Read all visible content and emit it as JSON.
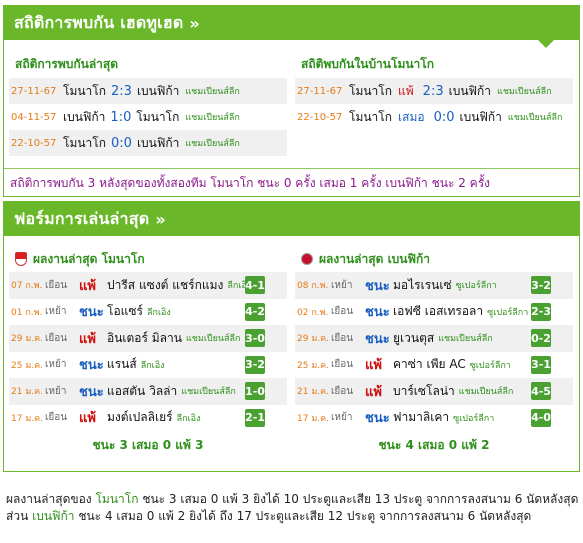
{
  "h2h": {
    "title": "สถิติการพบกัน เฮดทูเฮด",
    "chevron": "»",
    "recent_title": "สถิติการพบกันล่าสุด",
    "home_title": "สถิติพบกันในบ้านโมนาโก",
    "recent": [
      {
        "date": "27-11-67",
        "home": "โมนาโก",
        "score": "2:3",
        "away": "เบนฟิก้า",
        "league": "แชมเปียนส์ลีก"
      },
      {
        "date": "04-11-57",
        "home": "เบนฟิก้า",
        "score": "1:0",
        "away": "โมนาโก",
        "league": "แชมเปียนส์ลีก"
      },
      {
        "date": "22-10-57",
        "home": "โมนาโก",
        "score": "0:0",
        "away": "เบนฟิก้า",
        "league": "แชมเปียนส์ลีก"
      }
    ],
    "home": [
      {
        "date": "27-11-67",
        "home": "โมนาโก",
        "result": "แพ้",
        "score": "2:3",
        "away": "เบนฟิก้า",
        "league": "แชมเปียนส์ลีก"
      },
      {
        "date": "22-10-57",
        "home": "โมนาโก",
        "result": "เสมอ",
        "score": "0:0",
        "away": "เบนฟิก้า",
        "league": "แชมเปียนส์ลีก"
      }
    ],
    "summary": "สถิติการพบกัน 3 หลังสุดของทั้งสองทีม โมนาโก ชนะ 0 ครั้ง เสมอ 1 ครั้ง เบนฟิก้า ชนะ 2 ครั้ง"
  },
  "form": {
    "title": "ฟอร์มการเล่นล่าสุด",
    "chevron": "»",
    "monaco": {
      "title": "ผลงานล่าสุด โมนาโก",
      "rows": [
        {
          "date": "07 ก.พ.",
          "venue": "เยือน",
          "result": "แพ้",
          "code": "L",
          "opp": "ปารีส แซงต์ แชร์กแมง",
          "league": "ลีกเอิง",
          "score": "4-1"
        },
        {
          "date": "01 ก.พ.",
          "venue": "เหย้า",
          "result": "ชนะ",
          "code": "W",
          "opp": "โอแซร์",
          "league": "ลีกเอิง",
          "score": "4-2"
        },
        {
          "date": "29 ม.ค.",
          "venue": "เยือน",
          "result": "แพ้",
          "code": "L",
          "opp": "อินเตอร์ มิลาน",
          "league": "แชมเปียนส์ลีก",
          "score": "3-0"
        },
        {
          "date": "25 ม.ค.",
          "venue": "เหย้า",
          "result": "ชนะ",
          "code": "W",
          "opp": "แรนส์",
          "league": "ลีกเอิง",
          "score": "3-2"
        },
        {
          "date": "21 ม.ค.",
          "venue": "เหย้า",
          "result": "ชนะ",
          "code": "W",
          "opp": "แอสตัน วิลล่า",
          "league": "แชมเปียนส์ลีก",
          "score": "1-0"
        },
        {
          "date": "17 ม.ค.",
          "venue": "เยือน",
          "result": "แพ้",
          "code": "L",
          "opp": "มงต์เปลลิเยร์",
          "league": "ลีกเอิง",
          "score": "2-1"
        }
      ],
      "summary": "ชนะ 3 เสมอ 0 แพ้ 3"
    },
    "benfica": {
      "title": "ผลงานล่าสุด เบนฟิก้า",
      "rows": [
        {
          "date": "08 ก.พ.",
          "venue": "เหย้า",
          "result": "ชนะ",
          "code": "W",
          "opp": "มอไรเรนเซ่",
          "league": "ซูเปอร์ลีกา",
          "score": "3-2"
        },
        {
          "date": "02 ก.พ.",
          "venue": "เยือน",
          "result": "ชนะ",
          "code": "W",
          "opp": "เอฟซี เอสเทรอลา",
          "league": "ซูเปอร์ลีกา",
          "score": "2-3"
        },
        {
          "date": "29 ม.ค.",
          "venue": "เยือน",
          "result": "ชนะ",
          "code": "W",
          "opp": "ยูเวนตุส",
          "league": "แชมเปียนส์ลีก",
          "score": "0-2"
        },
        {
          "date": "25 ม.ค.",
          "venue": "เยือน",
          "result": "แพ้",
          "code": "L",
          "opp": "คาซ่า เพีย AC",
          "league": "ซูเปอร์ลีกา",
          "score": "3-1"
        },
        {
          "date": "21 ม.ค.",
          "venue": "เยือน",
          "result": "แพ้",
          "code": "L",
          "opp": "บาร์เซโลน่า",
          "league": "แชมเปียนส์ลีก",
          "score": "4-5"
        },
        {
          "date": "17 ม.ค.",
          "venue": "เหย้า",
          "result": "ชนะ",
          "code": "W",
          "opp": "ฟามาลิเคา",
          "league": "ซูเปอร์ลีกา",
          "score": "4-0"
        }
      ],
      "summary": "ชนะ 4 เสมอ 0 แพ้ 2"
    }
  },
  "footer": {
    "line1_a": "ผลงานล่าสุดของ ",
    "line1_team": "โมนาโก",
    "line1_b": " ชนะ 3 เสมอ 0 แพ้ 3 ยิงได้ 10 ประตูและเสีย 13 ประตู จากการลงสนาม 6 นัดหลังสุด",
    "line2_a": "ส่วน ",
    "line2_team": "เบนฟิก้า",
    "line2_b": " ชนะ 4 เสมอ 0 แพ้ 2 ยิงได้ ถึง 17 ประตูและเสีย 12 ประตู จากการลงสนาม 6 นัดหลังสุด"
  },
  "colors": {
    "accent": "#6ab82a",
    "win": "#1b5fbf",
    "loss": "#d01010",
    "date": "#e67a17"
  }
}
